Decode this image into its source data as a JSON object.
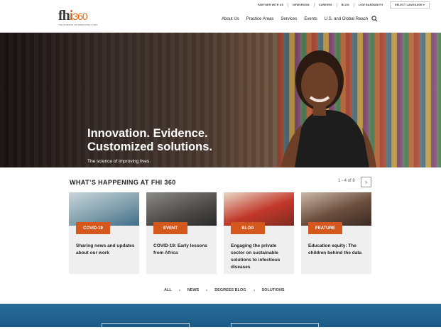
{
  "utility": {
    "items": [
      "PARTNER WITH US",
      "NEWSROOM",
      "CAREERS",
      "BLOG",
      "LOW BANDWIDTH"
    ],
    "language": "SELECT LANGUAGE"
  },
  "logo": {
    "text_a": "fh",
    "text_b": "i",
    "text_c": "360",
    "tagline": "THE SCIENCE OF IMPROVING LIVES"
  },
  "nav": [
    "About Us",
    "Practice Areas",
    "Services",
    "Events",
    "U.S. and Global Reach"
  ],
  "hero": {
    "headline_1": "Innovation. Evidence.",
    "headline_2": "Customized solutions.",
    "subhead": "The science of improving lives."
  },
  "happening": {
    "title": "WHAT’S HAPPENING AT FHI 360",
    "pager": "1 - 4 of 8"
  },
  "cards": [
    {
      "badge": "COVID-19",
      "title": "Sharing news and updates about our work",
      "color": "#7a9aa8"
    },
    {
      "badge": "EVENT",
      "title": "COVID-19: Early lessons from Africa",
      "color": "#4b4a48"
    },
    {
      "badge": "BLOG",
      "title": "Engaging the private sector on sustainable solutions to infectious diseases",
      "color": "#b04a3a"
    },
    {
      "badge": "FEATURE",
      "title": "Education equity: The children behind the data",
      "color": "#6b4e3e"
    }
  ],
  "filters": [
    "ALL",
    "NEWS",
    "DEGREES BLOG",
    "SOLUTIONS"
  ],
  "colors": {
    "accent": "#d4571c",
    "band": "#1f5f8c"
  }
}
